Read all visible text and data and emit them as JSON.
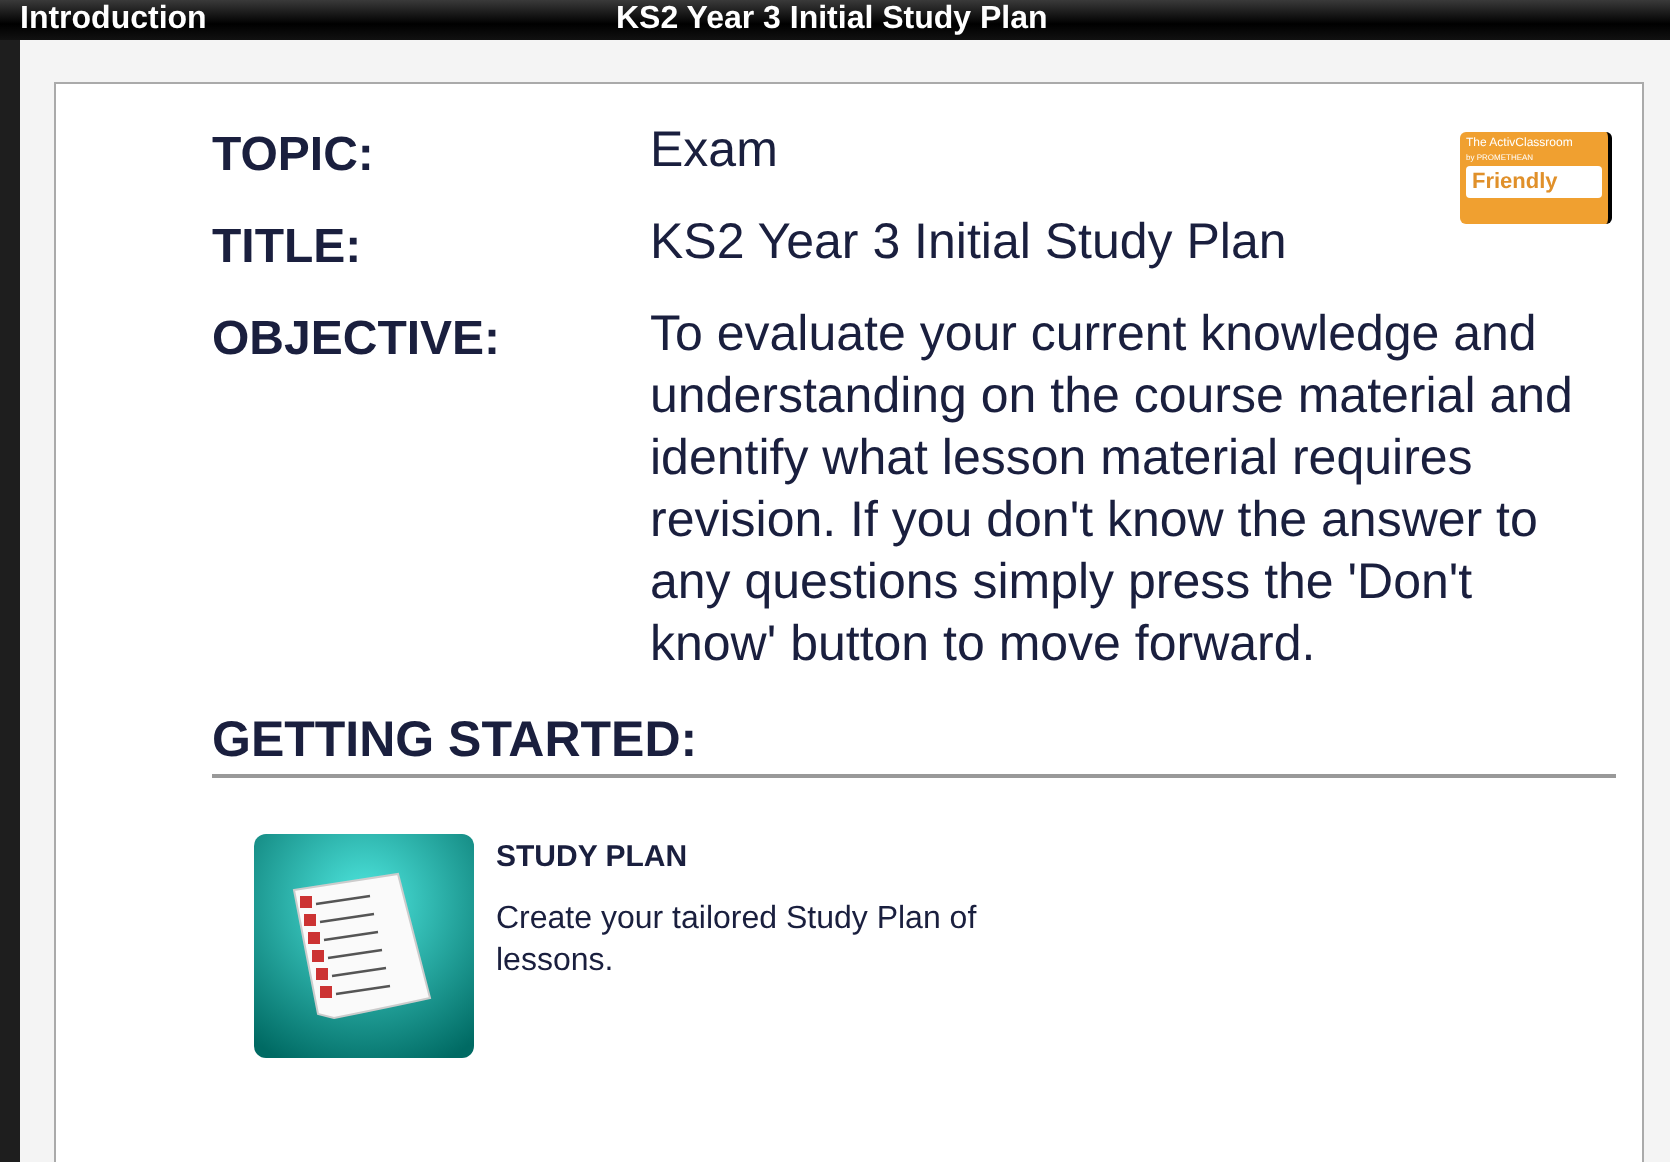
{
  "title_bar": {
    "section": "Introduction",
    "title": "KS2 Year 3 Initial Study Plan"
  },
  "badge": {
    "line_1": "The ActivClassroom",
    "line_2": "by PROMETHEAN",
    "line_3": "Friendly"
  },
  "fields": [
    {
      "label": "TOPIC:",
      "value": "Exam"
    },
    {
      "label": "TITLE:",
      "value": "KS2 Year 3 Initial Study Plan"
    },
    {
      "label": "OBJECTIVE:",
      "value": "To evaluate your current knowledge and understanding on the course material and identify what lesson material requires revision. If you don't know the answer to any questions simply press the 'Don't know' button to move forward."
    }
  ],
  "getting_started": {
    "heading": "GETTING STARTED:",
    "items": [
      {
        "title": "STUDY PLAN",
        "description": "Create your tailored Study Plan of lessons."
      }
    ]
  }
}
